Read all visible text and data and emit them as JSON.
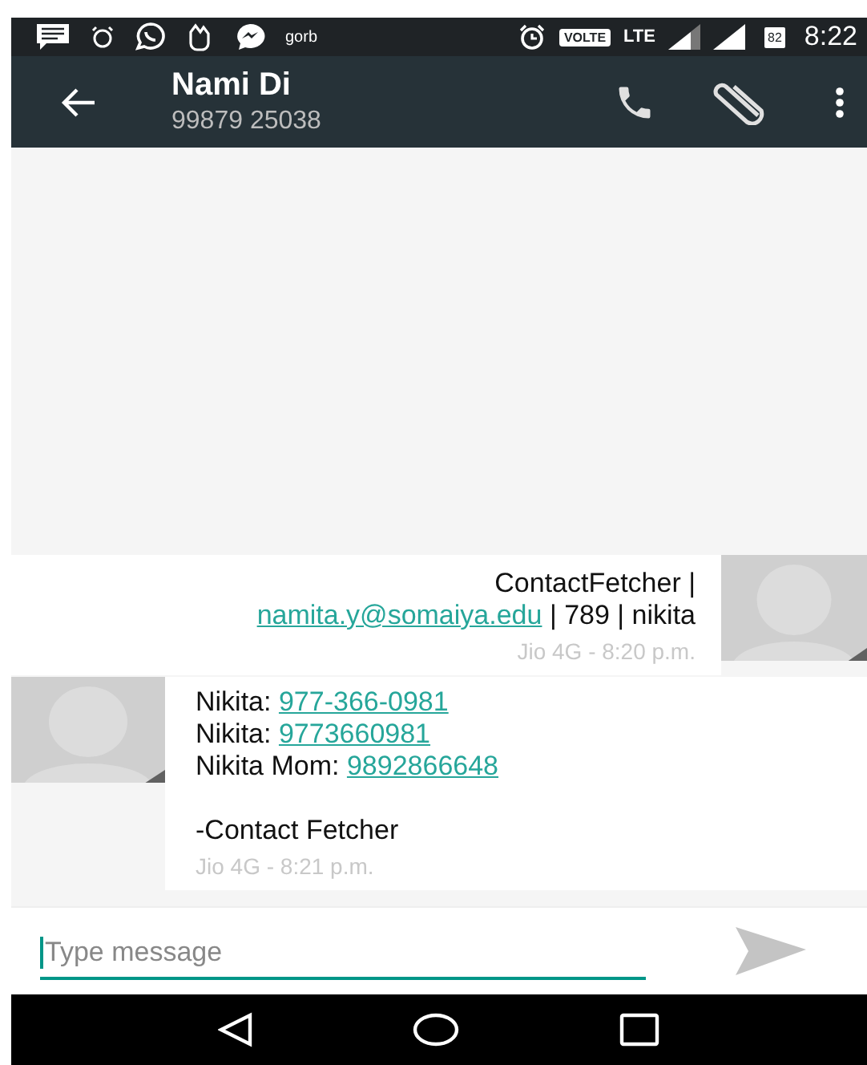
{
  "status_bar": {
    "network_label": "VOLTE",
    "data_label": "LTE",
    "battery": "82",
    "time": "8:22",
    "app_label": "gorb"
  },
  "toolbar": {
    "title": "Nami Di",
    "subtitle": "99879 25038"
  },
  "messages": [
    {
      "kind": "sent",
      "paragraphs": [
        [
          [
            {
              "kind": "plain",
              "text": "ContactFetcher |"
            }
          ],
          [
            {
              "kind": "link",
              "text": "namita.y@somaiya.edu"
            },
            {
              "kind": "plain",
              "text": " | 789 | nikita"
            }
          ]
        ]
      ],
      "meta": "Jio 4G - 8:20 p.m."
    },
    {
      "kind": "received",
      "paragraphs": [
        [
          [
            {
              "kind": "plain",
              "text": "Nikita: "
            },
            {
              "kind": "link",
              "text": "977-366-0981"
            }
          ],
          [
            {
              "kind": "plain",
              "text": "Nikita: "
            },
            {
              "kind": "link",
              "text": "9773660981"
            }
          ],
          [
            {
              "kind": "plain",
              "text": "Nikita Mom: "
            },
            {
              "kind": "link",
              "text": "9892866648"
            }
          ]
        ],
        [
          [
            {
              "kind": "plain",
              "text": "-Contact Fetcher"
            }
          ]
        ]
      ],
      "meta": "Jio 4G - 8:21 p.m."
    }
  ],
  "composer": {
    "placeholder": "Type message",
    "focused": true,
    "send_enabled": false
  }
}
